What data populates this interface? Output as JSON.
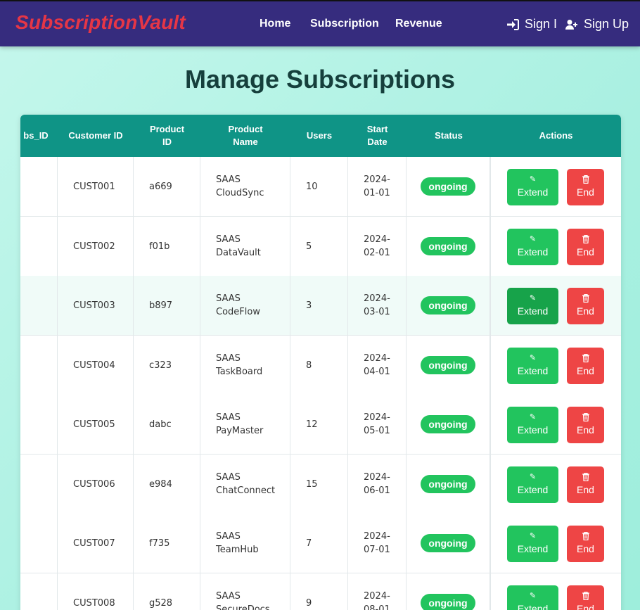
{
  "brand": "SubscriptionVault",
  "nav": {
    "home": "Home",
    "subscription": "Subscription",
    "revenue": "Revenue",
    "sign_in": "Sign I",
    "sign_up": "Sign Up"
  },
  "page_title": "Manage Subscriptions",
  "table": {
    "headers": {
      "subs_id": "bs_ID",
      "customer_id": "Customer ID",
      "product_id": "Product ID",
      "product_name": "Product Name",
      "users": "Users",
      "start_date": "Start Date",
      "status": "Status",
      "actions": "Actions"
    },
    "extend_label": "Extend",
    "end_label": "End",
    "rows": [
      {
        "customer_id": "CUST001",
        "product_id": "a669",
        "product_name_1": "SAAS",
        "product_name_2": "CloudSync",
        "users": "10",
        "date_1": "2024-",
        "date_2": "01-01",
        "status": "ongoing"
      },
      {
        "customer_id": "CUST002",
        "product_id": "f01b",
        "product_name_1": "SAAS",
        "product_name_2": "DataVault",
        "users": "5",
        "date_1": "2024-",
        "date_2": "02-01",
        "status": "ongoing"
      },
      {
        "customer_id": "CUST003",
        "product_id": "b897",
        "product_name_1": "SAAS",
        "product_name_2": "CodeFlow",
        "users": "3",
        "date_1": "2024-",
        "date_2": "03-01",
        "status": "ongoing"
      },
      {
        "customer_id": "CUST004",
        "product_id": "c323",
        "product_name_1": "SAAS",
        "product_name_2": "TaskBoard",
        "users": "8",
        "date_1": "2024-",
        "date_2": "04-01",
        "status": "ongoing"
      },
      {
        "customer_id": "CUST005",
        "product_id": "dabc",
        "product_name_1": "SAAS",
        "product_name_2": "PayMaster",
        "users": "12",
        "date_1": "2024-",
        "date_2": "05-01",
        "status": "ongoing"
      },
      {
        "customer_id": "CUST006",
        "product_id": "e984",
        "product_name_1": "SAAS",
        "product_name_2": "ChatConnect",
        "users": "15",
        "date_1": "2024-",
        "date_2": "06-01",
        "status": "ongoing"
      },
      {
        "customer_id": "CUST007",
        "product_id": "f735",
        "product_name_1": "SAAS",
        "product_name_2": "TeamHub",
        "users": "7",
        "date_1": "2024-",
        "date_2": "07-01",
        "status": "ongoing"
      },
      {
        "customer_id": "CUST008",
        "product_id": "g528",
        "product_name_1": "SAAS",
        "product_name_2": "SecureDocs",
        "users": "9",
        "date_1": "2024-",
        "date_2": "08-01",
        "status": "ongoing"
      }
    ]
  },
  "colors": {
    "navbar": "#362c7e",
    "brand": "#e63646",
    "table_header": "#0f9486",
    "status_badge": "#22c45e",
    "extend_button": "#22c45e",
    "end_button": "#ee4545"
  }
}
